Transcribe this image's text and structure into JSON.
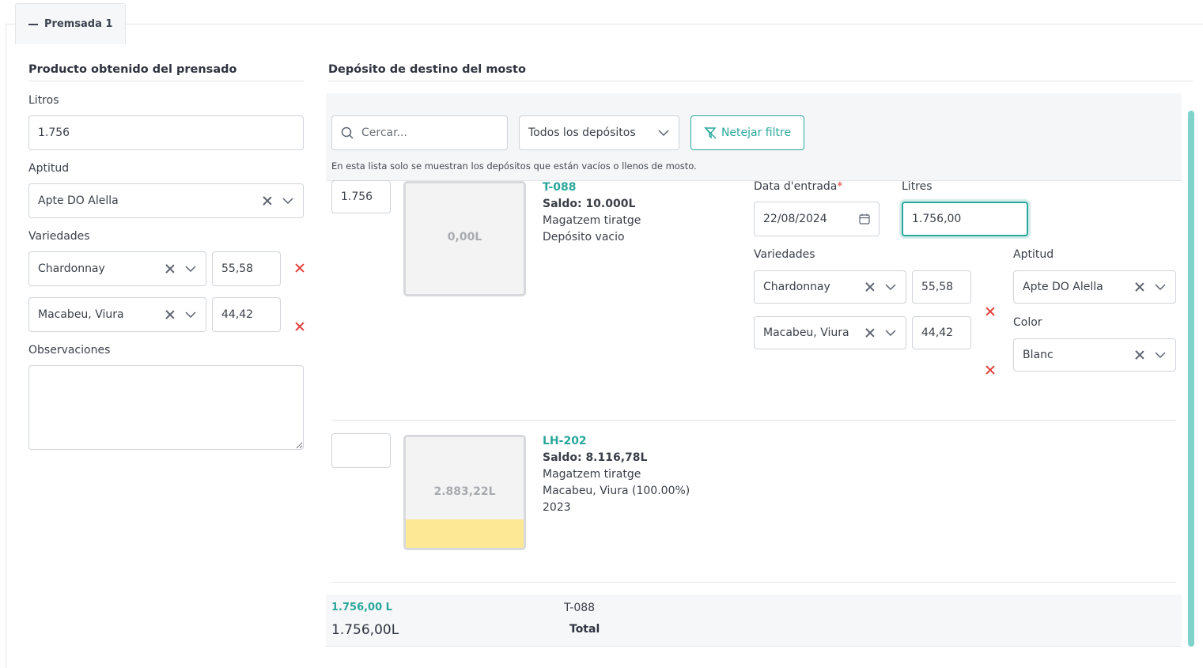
{
  "tab": {
    "label": "Premsada 1"
  },
  "left": {
    "title": "Producto obtenido del prensado",
    "litros_label": "Litros",
    "litros_value": "1.756",
    "aptitud_label": "Aptitud",
    "aptitud_value": "Apte DO Alella",
    "variedades_label": "Variedades",
    "variedades": [
      {
        "name": "Chardonnay",
        "pct": "55,58"
      },
      {
        "name": "Macabeu, Viura",
        "pct": "44,42"
      }
    ],
    "obs_label": "Observaciones",
    "obs_value": ""
  },
  "right": {
    "title": "Depósito de destino del mosto",
    "search_placeholder": "Cercar...",
    "deposit_filter": "Todos los depósitos",
    "clear_filter": "Netejar filtre",
    "note": "En esta lista solo se muestran los depósitos que están vacíos o llenos de mosto.",
    "tanks": [
      {
        "qty": "1.756",
        "fill_label": "0,00L",
        "fill_level": 0,
        "code": "T-088",
        "saldo": "Saldo: 10.000L",
        "location": "Magatzem tiratge",
        "desc": "Depósito vacio",
        "year": ""
      },
      {
        "qty": "",
        "fill_label": "2.883,22L",
        "fill_level": 0.26,
        "code": "LH-202",
        "saldo": "Saldo: 8.116,78L",
        "location": "Magatzem tiratge",
        "desc": "Macabeu, Viura (100.00%)",
        "year": "2023"
      }
    ],
    "detail": {
      "date_label": "Data d'entrada",
      "required_mark": "*",
      "date_value": "22/08/2024",
      "litres_label": "Litres",
      "litres_value": "1.756,00",
      "variedades_label": "Variedades",
      "variedades": [
        {
          "name": "Chardonnay",
          "pct": "55,58"
        },
        {
          "name": "Macabeu, Viura",
          "pct": "44,42"
        }
      ],
      "aptitud_label": "Aptitud",
      "aptitud_value": "Apte DO Alella",
      "color_label": "Color",
      "color_value": "Blanc"
    },
    "totals": {
      "row_amount": "1.756,00 L",
      "row_tank": "T-088",
      "total_amount": "1.756,00L",
      "total_label": "Total"
    }
  },
  "colors": {
    "accent": "#2aa79b",
    "danger": "#e0403a",
    "tank_fill": "#fde995"
  }
}
